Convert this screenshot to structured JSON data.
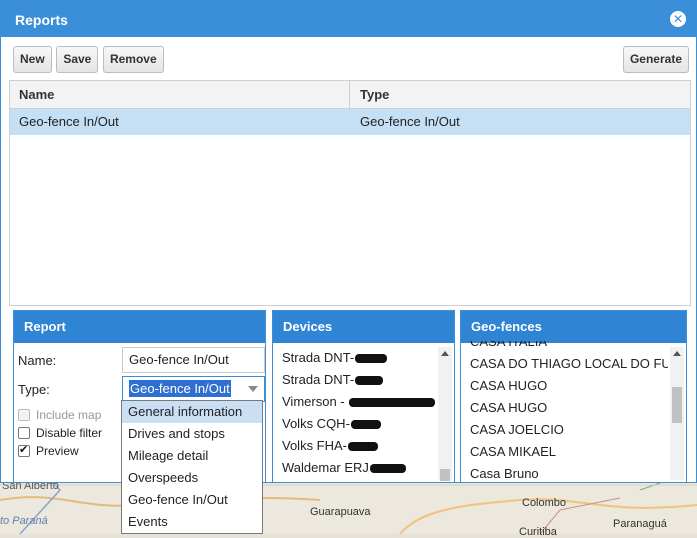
{
  "window": {
    "title": "Reports",
    "close_icon": "close-icon"
  },
  "toolbar": {
    "new_label": "New",
    "save_label": "Save",
    "remove_label": "Remove",
    "generate_label": "Generate"
  },
  "grid": {
    "columns": [
      "Name",
      "Type"
    ],
    "rows": [
      {
        "name": "Geo-fence In/Out",
        "type": "Geo-fence In/Out"
      }
    ]
  },
  "report": {
    "header": "Report",
    "name_label": "Name:",
    "name_value": "Geo-fence In/Out",
    "type_label": "Type:",
    "type_value": "Geo-fence In/Out",
    "include_map_label": "Include map",
    "disable_filter_label": "Disable filter",
    "preview_label": "Preview",
    "preview_checked": true,
    "include_map_checked": false,
    "disable_filter_checked": false
  },
  "type_options": [
    "General information",
    "Drives and stops",
    "Mileage detail",
    "Overspeeds",
    "Geo-fence In/Out",
    "Events"
  ],
  "devices": {
    "header": "Devices",
    "items": [
      "Strada DNT-",
      "Strada DNT-",
      "Vimerson - ",
      "Volks CQH-",
      "Volks FHA-",
      "Waldemar ERJ"
    ]
  },
  "geofences": {
    "header": "Geo-fences",
    "items": [
      "CASA ITALIA",
      "CASA DO THIAGO LOCAL DO FUNCIONARIO",
      "CASA HUGO",
      "CASA HUGO",
      "CASA JOELCIO",
      "CASA MIKAEL",
      "Casa Bruno"
    ]
  },
  "map_labels": {
    "city1": "Colombo",
    "city2": "Guarapuava",
    "city3": "Paranaguá",
    "city4": "Curitiba",
    "city5": "San Alberto",
    "river": "to Paraná"
  },
  "colors": {
    "accent": "#3b8fd9",
    "selected_row": "#c5dff4"
  }
}
